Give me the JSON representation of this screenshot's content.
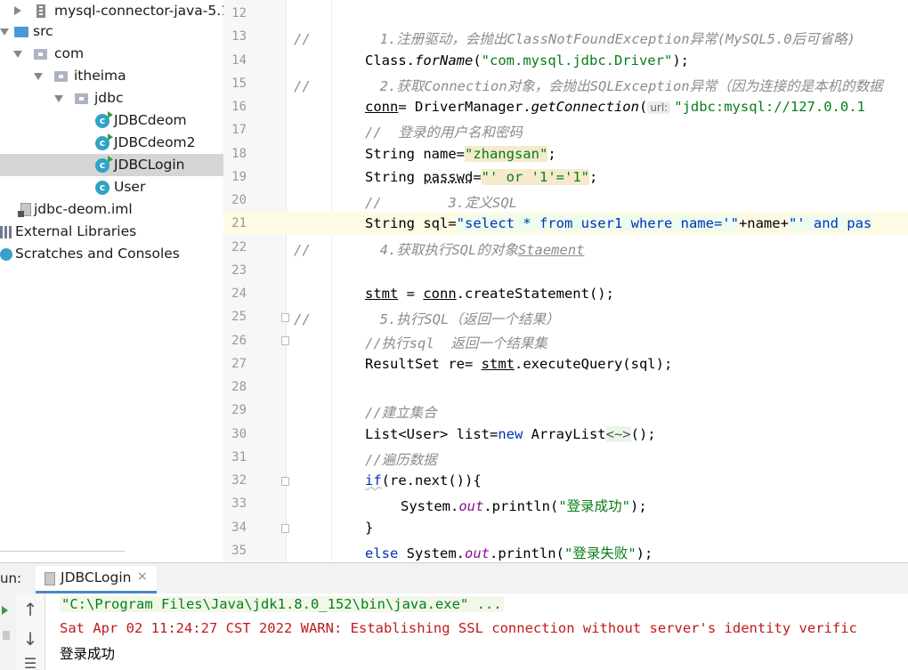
{
  "project_tree": {
    "items": [
      {
        "label": "mysql-connector-java-5.1.",
        "icon": "jar-icon"
      },
      {
        "label": "src",
        "icon": "source-folder-icon"
      },
      {
        "label": "com",
        "icon": "package-icon"
      },
      {
        "label": "itheima",
        "icon": "package-icon"
      },
      {
        "label": "jdbc",
        "icon": "package-icon"
      },
      {
        "label": "JDBCdeom",
        "icon": "java-class-icon"
      },
      {
        "label": "JDBCdeom2",
        "icon": "java-class-icon"
      },
      {
        "label": "JDBCLogin",
        "icon": "java-class-icon",
        "selected": true
      },
      {
        "label": "User",
        "icon": "java-class-icon"
      },
      {
        "label": "jdbc-deom.iml",
        "icon": "module-file-icon"
      },
      {
        "label": "External Libraries",
        "icon": "libraries-icon"
      },
      {
        "label": "Scratches and Consoles",
        "icon": "scratches-icon"
      }
    ]
  },
  "editor": {
    "line_numbers": [
      "12",
      "13",
      "14",
      "15",
      "16",
      "17",
      "18",
      "19",
      "20",
      "21",
      "22",
      "23",
      "24",
      "25",
      "26",
      "27",
      "28",
      "29",
      "30",
      "31",
      "32",
      "33",
      "34",
      "35"
    ],
    "current_line": "21",
    "code": {
      "l13_prefix": "//",
      "l13_comment": "1.注册驱动，会抛出ClassNotFoundException异常(MySQL5.0后可省略)",
      "l14_a": "Class.",
      "l14_fn": "forName",
      "l14_b": "(",
      "l14_str": "\"com.mysql.jdbc.Driver\"",
      "l14_c": ");",
      "l15_prefix": "//",
      "l15_comment": "2.获取Connection对象，会抛出SQLException异常（因为连接的是本机的数据",
      "l16_var": "conn",
      "l16_a": "= DriverManager.",
      "l16_fn": "getConnection",
      "l16_b": "(",
      "l16_hint": "url:",
      "l16_str": "\"jdbc:mysql://127.0.0.1",
      "l17_comment": "//  登录的用户名和密码",
      "l18_a": "String name=",
      "l18_str": "\"zhangsan\"",
      "l18_b": ";",
      "l19_a": "String ",
      "l19_var": "passwd",
      "l19_b": "=",
      "l19_str": "\"' or '1'='1\"",
      "l19_c": ";",
      "l20_comment": "//        3.定义SQL",
      "l21_a": "String sql=",
      "l21_str1": "\"select * from user1 where name='\"",
      "l21_b": "+name+",
      "l21_str2": "\"' and pas",
      "l22_prefix": "//",
      "l22_comment": "4.获取执行SQL的对象",
      "l22_comment_u": "Staement",
      "l24_var1": "stmt",
      "l24_a": " = ",
      "l24_var2": "conn",
      "l24_b": ".createStatement();",
      "l25_prefix": "//",
      "l25_comment": "5.执行SQL（返回一个结果）",
      "l26_comment": "//执行sql  返回一个结果集",
      "l27_a": "ResultSet re= ",
      "l27_var": "stmt",
      "l27_b": ".executeQuery(sql);",
      "l29_comment": "//建立集合",
      "l30_a": "List<User> list=",
      "l30_kw": "new",
      "l30_b": " ArrayList",
      "l30_diamond": "<~>",
      "l30_c": "();",
      "l31_comment": "//遍历数据",
      "l32_kw": "if",
      "l32_a": "(re.next()){",
      "l33_a": "System.",
      "l33_fld": "out",
      "l33_b": ".println(",
      "l33_str": "\"登录成功\"",
      "l33_c": ");",
      "l34_a": "}",
      "l35_kw": "else",
      "l35_a": " System.",
      "l35_fld": "out",
      "l35_b": ".println(",
      "l35_str": "\"登录失败\"",
      "l35_c": ");"
    }
  },
  "run_panel": {
    "label": "un:",
    "tab_label": "JDBCLogin",
    "close_glyph": "×",
    "tools": [
      "↑",
      "↓",
      "☰"
    ],
    "console_lines": [
      "\"C:\\Program Files\\Java\\jdk1.8.0_152\\bin\\java.exe\" ...",
      "Sat Apr 02 11:24:27 CST 2022 WARN: Establishing SSL connection without server's identity verific",
      "登录成功"
    ]
  }
}
